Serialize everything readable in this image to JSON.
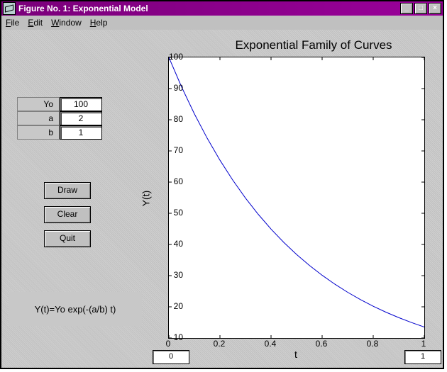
{
  "window": {
    "title": "Figure No. 1: Exponential Model"
  },
  "menubar": {
    "file": "File",
    "edit": "Edit",
    "window": "Window",
    "help": "Help"
  },
  "params": {
    "Yo_label": "Yo",
    "Yo_value": "100",
    "a_label": "a",
    "a_value": "2",
    "b_label": "b",
    "b_value": "1"
  },
  "buttons": {
    "draw": "Draw",
    "clear": "Clear",
    "quit": "Quit"
  },
  "formula": "Y(t)=Yo exp(-(a/b) t)",
  "axis_boxes": {
    "xmin": "0",
    "xmax": "1"
  },
  "chart_data": {
    "type": "line",
    "title": "Exponential Family of Curves",
    "xlabel": "t",
    "ylabel": "Y(t)",
    "xlim": [
      0,
      1
    ],
    "ylim": [
      10,
      100
    ],
    "xticks": [
      0,
      0.2,
      0.4,
      0.6,
      0.8,
      1
    ],
    "yticks": [
      10,
      20,
      30,
      40,
      50,
      60,
      70,
      80,
      90,
      100
    ],
    "series": [
      {
        "name": "Y(t)",
        "color": "#0000cc",
        "x": [
          0.0,
          0.05,
          0.1,
          0.15,
          0.2,
          0.25,
          0.3,
          0.35,
          0.4,
          0.45,
          0.5,
          0.55,
          0.6,
          0.65,
          0.7,
          0.75,
          0.8,
          0.85,
          0.9,
          0.95,
          1.0
        ],
        "y": [
          100.0,
          90.48,
          81.87,
          74.08,
          67.03,
          60.65,
          54.88,
          49.66,
          44.93,
          40.66,
          36.79,
          33.29,
          30.12,
          27.25,
          24.66,
          22.31,
          20.19,
          18.27,
          16.53,
          14.96,
          13.53
        ]
      }
    ]
  }
}
